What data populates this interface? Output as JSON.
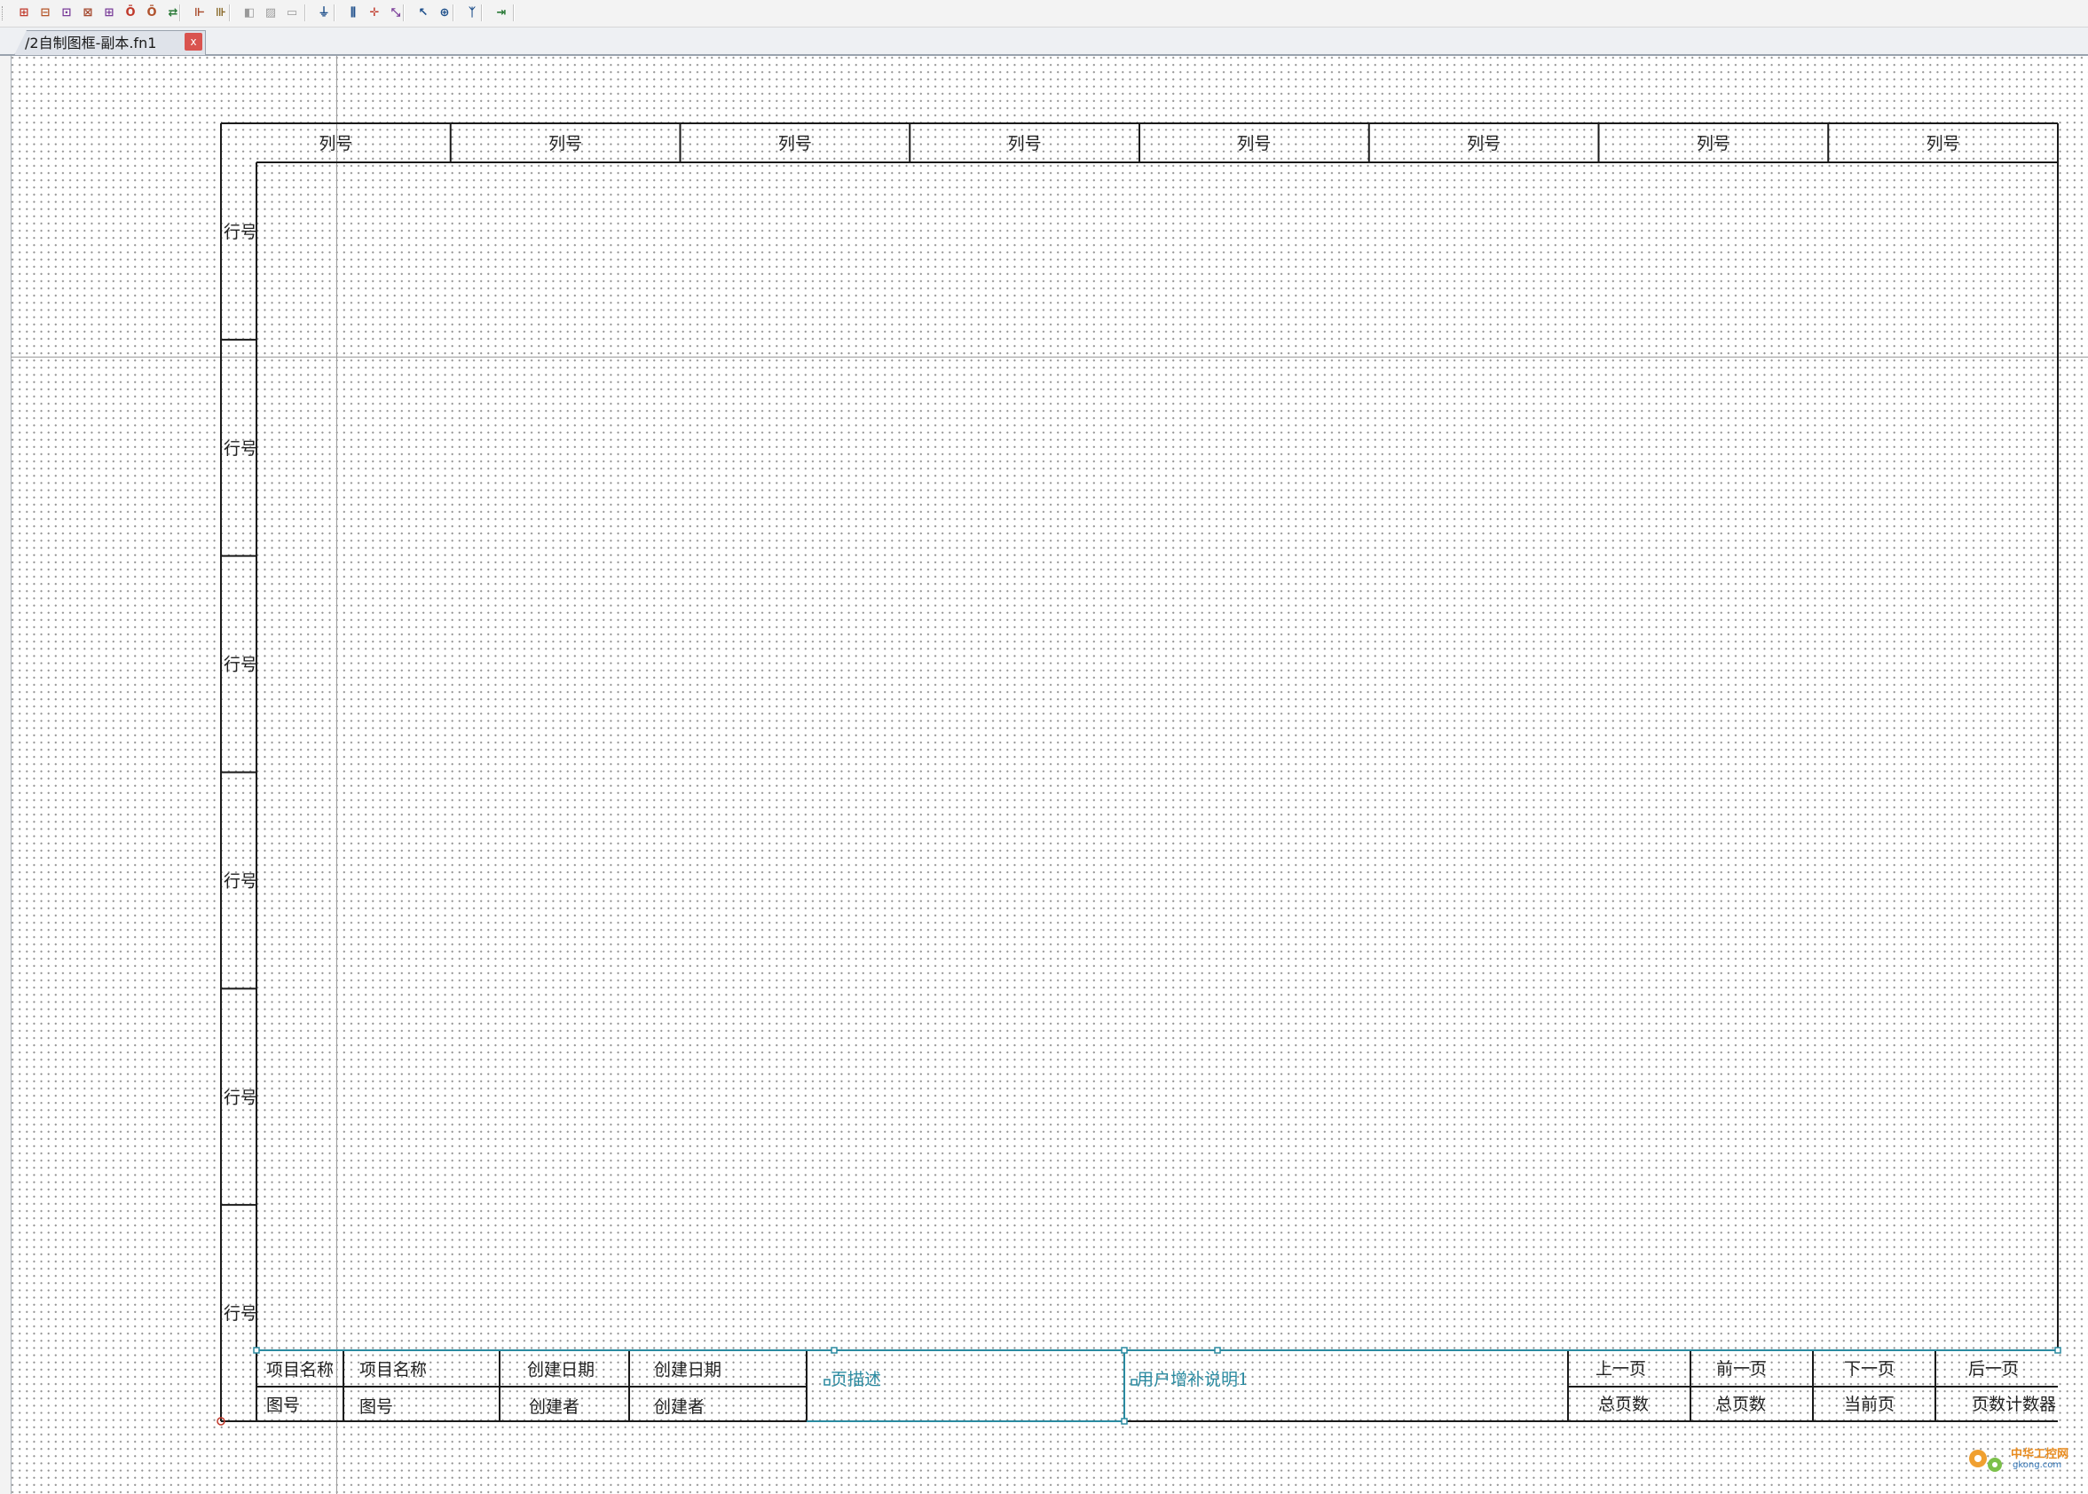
{
  "toolbar": {
    "buttons": [
      {
        "name": "insert-terminal-strip-icon",
        "glyph": "⊞",
        "color": "#c0392b"
      },
      {
        "name": "insert-device-icon",
        "glyph": "⊟",
        "color": "#b5562a"
      },
      {
        "name": "insert-plug-icon",
        "glyph": "⊡",
        "color": "#7a3d99"
      },
      {
        "name": "insert-connector-icon",
        "glyph": "⊠",
        "color": "#a3462c"
      },
      {
        "name": "insert-cable-icon",
        "glyph": "⊞",
        "color": "#7a3d99"
      },
      {
        "name": "insert-potential-icon",
        "glyph": "Ō",
        "color": "#c0392b"
      },
      {
        "name": "insert-interruption-icon",
        "glyph": "Ō",
        "color": "#b0522d"
      },
      {
        "name": "insert-bridge-icon",
        "glyph": "⇄",
        "color": "#2a7a38"
      },
      {
        "name": "insert-symbol-icon",
        "glyph": "⊩",
        "color": "#a84a2a"
      },
      {
        "name": "insert-contact-icon",
        "glyph": "⊪",
        "color": "#8a6a2a"
      },
      {
        "name": "insert-macro-icon",
        "glyph": "◧",
        "color": "#999999"
      },
      {
        "name": "insert-window-macro-icon",
        "glyph": "▨",
        "color": "#999999"
      },
      {
        "name": "insert-placeholder-icon",
        "glyph": "▭",
        "color": "#999999"
      },
      {
        "name": "insert-ground-icon",
        "glyph": "⏚",
        "color": "#1c4e8a"
      },
      {
        "name": "insert-terminal-icon",
        "glyph": "⫼",
        "color": "#1c4e8a"
      },
      {
        "name": "insert-junction-icon",
        "glyph": "✛",
        "color": "#c0392b"
      },
      {
        "name": "insert-angle-icon",
        "glyph": "⤡",
        "color": "#7a3d99"
      },
      {
        "name": "insert-corner-icon",
        "glyph": "↖",
        "color": "#1c4e8a"
      },
      {
        "name": "insert-cross-icon",
        "glyph": "⊕",
        "color": "#1c4e8a"
      },
      {
        "name": "insert-branch-icon",
        "glyph": "ᛉ",
        "color": "#1c4e8a"
      },
      {
        "name": "insert-interrupt-point-icon",
        "glyph": "⇥",
        "color": "#2a7a38"
      }
    ]
  },
  "tab": {
    "title": "/2自制图框-副本.fn1",
    "close": "x"
  },
  "frame": {
    "column_label": "列号",
    "row_label": "行号",
    "columns": [
      "列号",
      "列号",
      "列号",
      "列号",
      "列号",
      "列号",
      "列号",
      "列号"
    ],
    "rows": [
      "行号",
      "行号",
      "行号",
      "行号",
      "行号",
      "行号"
    ],
    "title_block": {
      "project_name_label": "项目名称",
      "project_name_value": "项目名称",
      "drawing_no_label": "图号",
      "drawing_no_value": "图号",
      "created_date_label": "创建日期",
      "created_date_value": "创建日期",
      "creator_label": "创建者",
      "creator_value": "创建者",
      "description": "页描述",
      "user_note": "用户增补说明1",
      "prev_page_label": "上一页",
      "previous_page_label": "前一页",
      "next_page_label": "下一页",
      "following_page_label": "后一页",
      "total_pages_label": "总页数",
      "total_pages_value": "总页数",
      "current_page_label": "当前页",
      "page_counter": "页数计数器"
    }
  },
  "watermark": {
    "text": "中华工控网",
    "sub": "gkong.com"
  }
}
